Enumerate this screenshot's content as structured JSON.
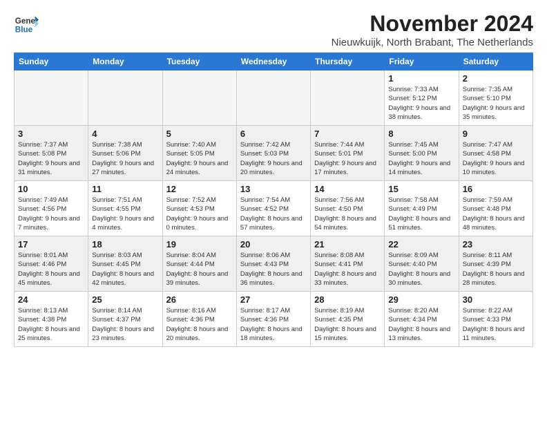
{
  "header": {
    "logo_line1": "General",
    "logo_line2": "Blue",
    "month_title": "November 2024",
    "subtitle": "Nieuwkuijk, North Brabant, The Netherlands"
  },
  "weekdays": [
    "Sunday",
    "Monday",
    "Tuesday",
    "Wednesday",
    "Thursday",
    "Friday",
    "Saturday"
  ],
  "weeks": [
    [
      {
        "day": "",
        "info": ""
      },
      {
        "day": "",
        "info": ""
      },
      {
        "day": "",
        "info": ""
      },
      {
        "day": "",
        "info": ""
      },
      {
        "day": "",
        "info": ""
      },
      {
        "day": "1",
        "info": "Sunrise: 7:33 AM\nSunset: 5:12 PM\nDaylight: 9 hours\nand 38 minutes."
      },
      {
        "day": "2",
        "info": "Sunrise: 7:35 AM\nSunset: 5:10 PM\nDaylight: 9 hours\nand 35 minutes."
      }
    ],
    [
      {
        "day": "3",
        "info": "Sunrise: 7:37 AM\nSunset: 5:08 PM\nDaylight: 9 hours\nand 31 minutes."
      },
      {
        "day": "4",
        "info": "Sunrise: 7:38 AM\nSunset: 5:06 PM\nDaylight: 9 hours\nand 27 minutes."
      },
      {
        "day": "5",
        "info": "Sunrise: 7:40 AM\nSunset: 5:05 PM\nDaylight: 9 hours\nand 24 minutes."
      },
      {
        "day": "6",
        "info": "Sunrise: 7:42 AM\nSunset: 5:03 PM\nDaylight: 9 hours\nand 20 minutes."
      },
      {
        "day": "7",
        "info": "Sunrise: 7:44 AM\nSunset: 5:01 PM\nDaylight: 9 hours\nand 17 minutes."
      },
      {
        "day": "8",
        "info": "Sunrise: 7:45 AM\nSunset: 5:00 PM\nDaylight: 9 hours\nand 14 minutes."
      },
      {
        "day": "9",
        "info": "Sunrise: 7:47 AM\nSunset: 4:58 PM\nDaylight: 9 hours\nand 10 minutes."
      }
    ],
    [
      {
        "day": "10",
        "info": "Sunrise: 7:49 AM\nSunset: 4:56 PM\nDaylight: 9 hours\nand 7 minutes."
      },
      {
        "day": "11",
        "info": "Sunrise: 7:51 AM\nSunset: 4:55 PM\nDaylight: 9 hours\nand 4 minutes."
      },
      {
        "day": "12",
        "info": "Sunrise: 7:52 AM\nSunset: 4:53 PM\nDaylight: 9 hours\nand 0 minutes."
      },
      {
        "day": "13",
        "info": "Sunrise: 7:54 AM\nSunset: 4:52 PM\nDaylight: 8 hours\nand 57 minutes."
      },
      {
        "day": "14",
        "info": "Sunrise: 7:56 AM\nSunset: 4:50 PM\nDaylight: 8 hours\nand 54 minutes."
      },
      {
        "day": "15",
        "info": "Sunrise: 7:58 AM\nSunset: 4:49 PM\nDaylight: 8 hours\nand 51 minutes."
      },
      {
        "day": "16",
        "info": "Sunrise: 7:59 AM\nSunset: 4:48 PM\nDaylight: 8 hours\nand 48 minutes."
      }
    ],
    [
      {
        "day": "17",
        "info": "Sunrise: 8:01 AM\nSunset: 4:46 PM\nDaylight: 8 hours\nand 45 minutes."
      },
      {
        "day": "18",
        "info": "Sunrise: 8:03 AM\nSunset: 4:45 PM\nDaylight: 8 hours\nand 42 minutes."
      },
      {
        "day": "19",
        "info": "Sunrise: 8:04 AM\nSunset: 4:44 PM\nDaylight: 8 hours\nand 39 minutes."
      },
      {
        "day": "20",
        "info": "Sunrise: 8:06 AM\nSunset: 4:43 PM\nDaylight: 8 hours\nand 36 minutes."
      },
      {
        "day": "21",
        "info": "Sunrise: 8:08 AM\nSunset: 4:41 PM\nDaylight: 8 hours\nand 33 minutes."
      },
      {
        "day": "22",
        "info": "Sunrise: 8:09 AM\nSunset: 4:40 PM\nDaylight: 8 hours\nand 30 minutes."
      },
      {
        "day": "23",
        "info": "Sunrise: 8:11 AM\nSunset: 4:39 PM\nDaylight: 8 hours\nand 28 minutes."
      }
    ],
    [
      {
        "day": "24",
        "info": "Sunrise: 8:13 AM\nSunset: 4:38 PM\nDaylight: 8 hours\nand 25 minutes."
      },
      {
        "day": "25",
        "info": "Sunrise: 8:14 AM\nSunset: 4:37 PM\nDaylight: 8 hours\nand 23 minutes."
      },
      {
        "day": "26",
        "info": "Sunrise: 8:16 AM\nSunset: 4:36 PM\nDaylight: 8 hours\nand 20 minutes."
      },
      {
        "day": "27",
        "info": "Sunrise: 8:17 AM\nSunset: 4:36 PM\nDaylight: 8 hours\nand 18 minutes."
      },
      {
        "day": "28",
        "info": "Sunrise: 8:19 AM\nSunset: 4:35 PM\nDaylight: 8 hours\nand 15 minutes."
      },
      {
        "day": "29",
        "info": "Sunrise: 8:20 AM\nSunset: 4:34 PM\nDaylight: 8 hours\nand 13 minutes."
      },
      {
        "day": "30",
        "info": "Sunrise: 8:22 AM\nSunset: 4:33 PM\nDaylight: 8 hours\nand 11 minutes."
      }
    ]
  ]
}
